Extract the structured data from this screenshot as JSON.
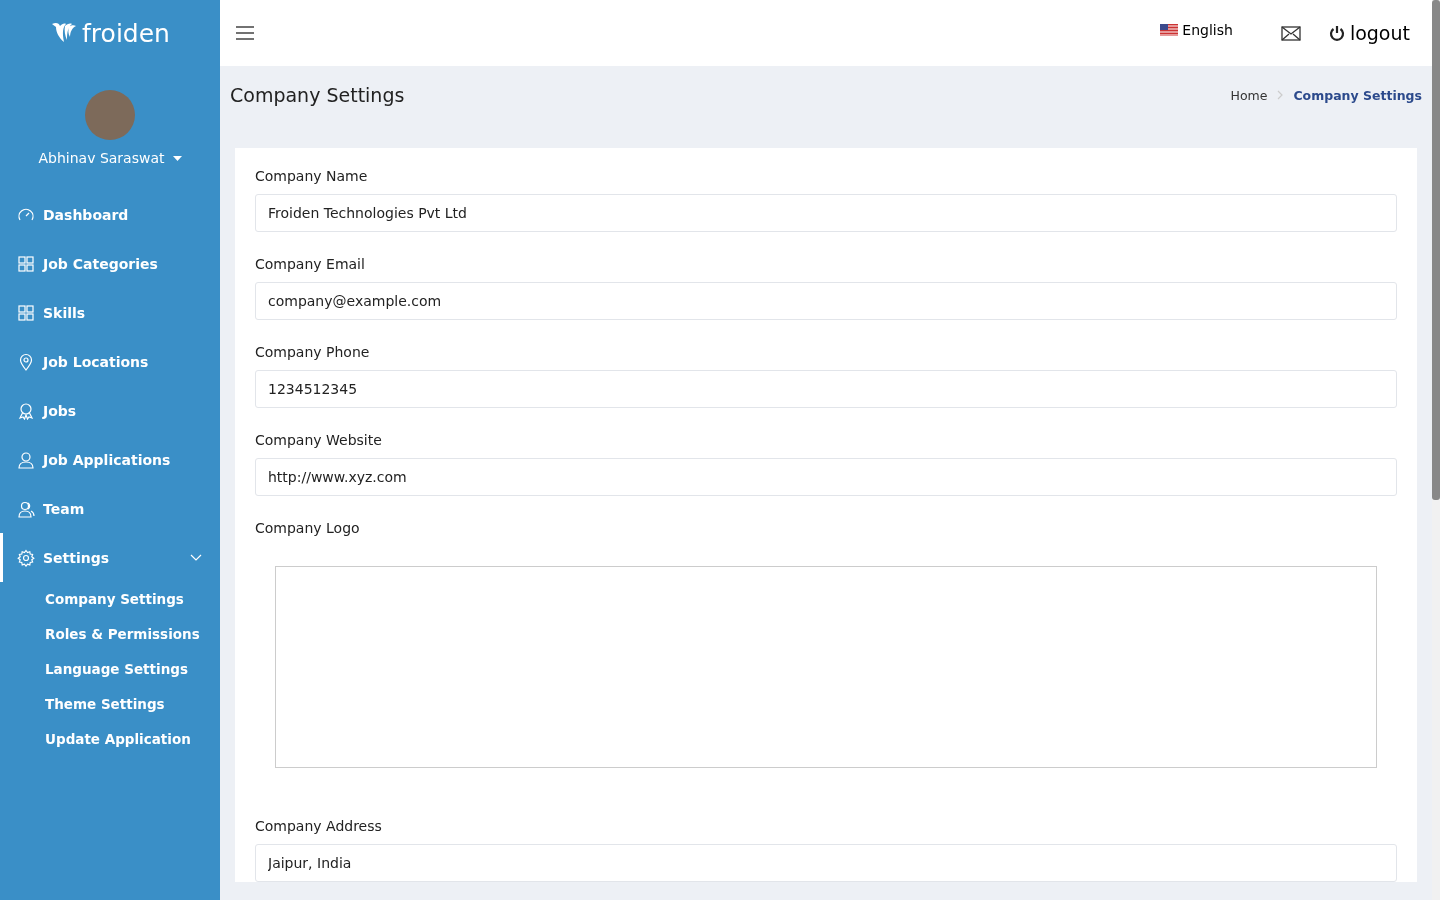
{
  "sidebar": {
    "logo": "froiden",
    "user": {
      "name": "Abhinav Saraswat"
    },
    "items": [
      {
        "label": "Dashboard",
        "selected": false
      },
      {
        "label": "Job Categories",
        "selected": false
      },
      {
        "label": "Skills",
        "selected": false
      },
      {
        "label": "Job Locations",
        "selected": false
      },
      {
        "label": "Jobs",
        "selected": false
      },
      {
        "label": "Job Applications",
        "selected": false
      },
      {
        "label": "Team",
        "selected": false
      },
      {
        "label": "Settings",
        "selected": true,
        "expanded": true,
        "children": [
          {
            "label": "Company Settings"
          },
          {
            "label": "Roles & Permissions"
          },
          {
            "label": "Language Settings"
          },
          {
            "label": "Theme Settings"
          },
          {
            "label": "Update Application"
          }
        ]
      }
    ]
  },
  "topbar": {
    "language": "English",
    "logout": "logout"
  },
  "page": {
    "title": "Company Settings",
    "breadcrumb": [
      {
        "label": "Home",
        "current": false
      },
      {
        "label": "Company Settings",
        "current": true
      }
    ]
  },
  "form": {
    "fields": [
      {
        "kind": "text",
        "label": "Company Name",
        "value": "Froiden Technologies Pvt Ltd"
      },
      {
        "kind": "text",
        "label": "Company Email",
        "value": "company@example.com"
      },
      {
        "kind": "text",
        "label": "Company Phone",
        "value": "1234512345"
      },
      {
        "kind": "text",
        "label": "Company Website",
        "value": "http://www.xyz.com"
      },
      {
        "kind": "image",
        "label": "Company Logo"
      },
      {
        "kind": "text",
        "label": "Company Address",
        "value": "Jaipur, India"
      }
    ]
  }
}
